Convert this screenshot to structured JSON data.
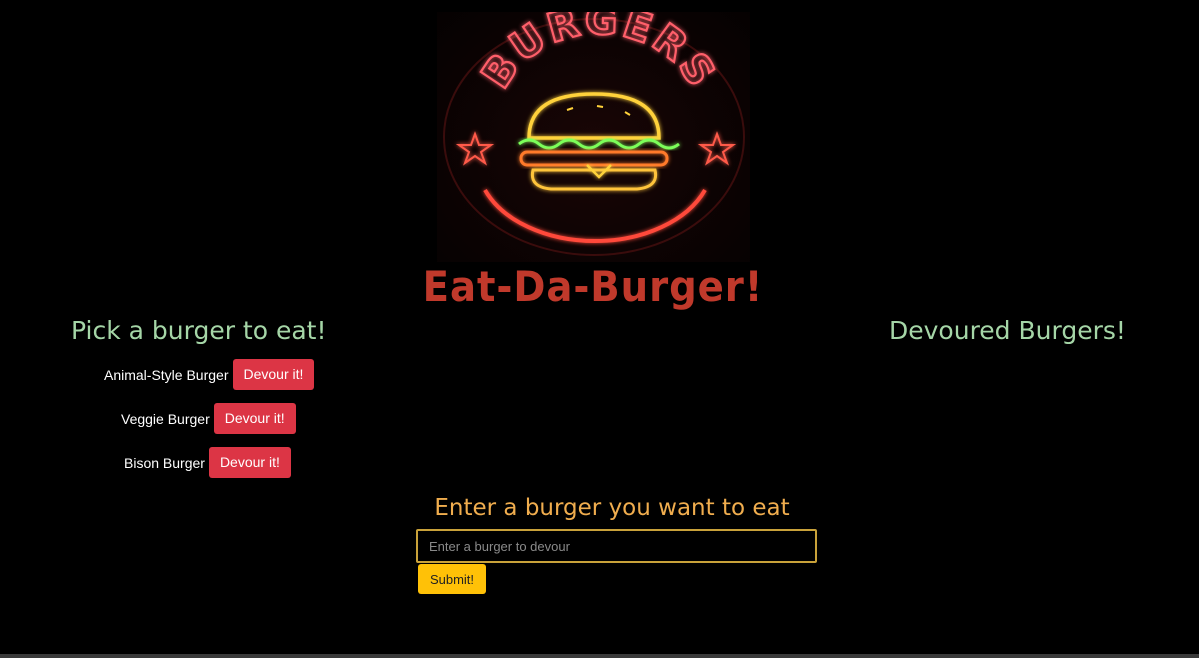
{
  "logo": {
    "sign_text": "BURGERS",
    "icon": "neon-burger-sign"
  },
  "header": {
    "title": "Eat-Da-Burger!"
  },
  "left_column": {
    "heading": "Pick a burger to eat!",
    "burgers": [
      {
        "name": "Animal-Style Burger",
        "button": "Devour it!"
      },
      {
        "name": "Veggie Burger",
        "button": "Devour it!"
      },
      {
        "name": "Bison Burger",
        "button": "Devour it!"
      }
    ]
  },
  "right_column": {
    "heading": "Devoured Burgers!"
  },
  "form": {
    "heading": "Enter a burger you want to eat",
    "input_value": "",
    "input_placeholder": "Enter a burger to devour",
    "submit_label": "Submit!"
  },
  "colors": {
    "title": "#c0392b",
    "column_heading": "#a5d6a7",
    "form_heading": "#f0ad4e",
    "devour_button": "#dc3545",
    "submit_button": "#ffc107",
    "input_border": "#c9a23a"
  }
}
